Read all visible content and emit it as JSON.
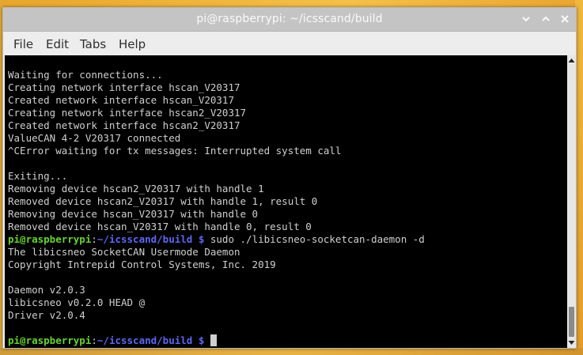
{
  "window": {
    "title": "pi@raspberrypi: ~/icsscand/build",
    "buttons": [
      "minimize",
      "maximize",
      "close"
    ]
  },
  "menu": {
    "items": [
      "File",
      "Edit",
      "Tabs",
      "Help"
    ]
  },
  "terminal": {
    "lines": [
      "Waiting for connections...",
      "Creating network interface hscan_V20317",
      "Created network interface hscan_V20317",
      "Creating network interface hscan2_V20317",
      "Created network interface hscan2_V20317",
      "ValueCAN 4-2 V20317 connected",
      "^CError waiting for tx messages: Interrupted system call",
      "",
      "Exiting...",
      "Removing device hscan2_V20317 with handle 1",
      "Removed device hscan2_V20317 with handle 1, result 0",
      "Removing device hscan_V20317 with handle 0",
      "Removed device hscan_V20317 with handle 0, result 0"
    ],
    "prompt": {
      "user": "pi@raspberrypi",
      "colon": ":",
      "path": "~/icsscand/build $",
      "command": " sudo ./libicsneo-socketcan-daemon -d"
    },
    "output_lines": [
      "The libicsneo SocketCAN Usermode Daemon",
      "Copyright Intrepid Control Systems, Inc. 2019",
      "",
      "Daemon v2.0.3",
      "libicsneo v0.2.0 HEAD @",
      "Driver v2.0.4",
      ""
    ],
    "final_prompt": {
      "user": "pi@raspberrypi",
      "colon": ":",
      "path": "~/icsscand/build $",
      "command": " "
    }
  },
  "colors": {
    "terminal_bg": "#000000",
    "text": "#cfcfcf",
    "prompt_user": "#66d42e",
    "prompt_path": "#5c67f0",
    "titlebar": "#c4c4c4"
  },
  "icons": {
    "minimize": "chevron-down-icon",
    "maximize": "chevron-up-icon",
    "close": "close-icon"
  }
}
